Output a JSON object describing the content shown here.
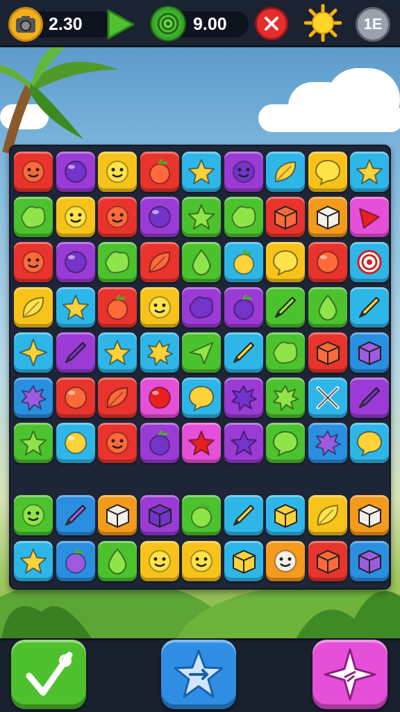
{
  "hud": {
    "coins_value": "2.30",
    "gems_value": "9.00",
    "level_badge": "1E"
  },
  "colors": {
    "red": "#e8342c",
    "purple": "#9b3bd6",
    "yellow": "#f7c31b",
    "cyan": "#2fb6e8",
    "green": "#4cc22f",
    "orange": "#f49a1c",
    "blue": "#2a8fe0",
    "pink": "#e64fd8"
  },
  "board": {
    "rows": [
      [
        [
          "red",
          "face"
        ],
        [
          "purple",
          "ball"
        ],
        [
          "yellow",
          "face"
        ],
        [
          "red",
          "apple"
        ],
        [
          "cyan",
          "star"
        ],
        [
          "purple",
          "face"
        ],
        [
          "cyan",
          "leaf"
        ],
        [
          "yellow",
          "bubble"
        ],
        [
          "cyan",
          "star"
        ]
      ],
      [
        [
          "green",
          "blob"
        ],
        [
          "yellow",
          "face"
        ],
        [
          "red",
          "face"
        ],
        [
          "purple",
          "ball"
        ],
        [
          "green",
          "star"
        ],
        [
          "green",
          "blob"
        ],
        [
          "red",
          "box"
        ],
        [
          "orange",
          "box"
        ],
        [
          "pink",
          "triangle"
        ]
      ],
      [
        [
          "red",
          "face"
        ],
        [
          "purple",
          "ball"
        ],
        [
          "green",
          "blob"
        ],
        [
          "red",
          "leaf"
        ],
        [
          "green",
          "drop"
        ],
        [
          "cyan",
          "apple"
        ],
        [
          "yellow",
          "bubble"
        ],
        [
          "red",
          "ball"
        ],
        [
          "cyan",
          "target"
        ]
      ],
      [
        [
          "yellow",
          "leaf"
        ],
        [
          "cyan",
          "star"
        ],
        [
          "red",
          "apple"
        ],
        [
          "yellow",
          "face"
        ],
        [
          "purple",
          "blob"
        ],
        [
          "purple",
          "apple"
        ],
        [
          "green",
          "pencil"
        ],
        [
          "green",
          "drop"
        ],
        [
          "cyan",
          "pencil"
        ]
      ],
      [
        [
          "cyan",
          "star4"
        ],
        [
          "purple",
          "pencil"
        ],
        [
          "cyan",
          "star"
        ],
        [
          "cyan",
          "splat"
        ],
        [
          "green",
          "plane"
        ],
        [
          "cyan",
          "pencil"
        ],
        [
          "green",
          "blob"
        ],
        [
          "red",
          "box"
        ],
        [
          "blue",
          "box"
        ]
      ],
      [
        [
          "blue",
          "splat"
        ],
        [
          "red",
          "ball"
        ],
        [
          "red",
          "leaf"
        ],
        [
          "pink",
          "ball"
        ],
        [
          "cyan",
          "bubble"
        ],
        [
          "purple",
          "splat"
        ],
        [
          "green",
          "splat"
        ],
        [
          "cyan",
          "tools"
        ],
        [
          "purple",
          "pencil"
        ]
      ],
      [
        [
          "green",
          "star"
        ],
        [
          "cyan",
          "ball"
        ],
        [
          "red",
          "face"
        ],
        [
          "purple",
          "apple"
        ],
        [
          "pink",
          "star"
        ],
        [
          "purple",
          "star"
        ],
        [
          "green",
          "bubble"
        ],
        [
          "blue",
          "splat"
        ],
        [
          "cyan",
          "bubble"
        ]
      ],
      [
        [
          "green",
          "face"
        ],
        [
          "blue",
          "pencil"
        ],
        [
          "orange",
          "box"
        ],
        [
          "purple",
          "box"
        ],
        [
          "green",
          "apple"
        ],
        [
          "cyan",
          "pencil"
        ],
        [
          "cyan",
          "box"
        ],
        [
          "yellow",
          "leaf"
        ],
        [
          "orange",
          "box"
        ]
      ],
      [
        [
          "cyan",
          "star"
        ],
        [
          "blue",
          "apple"
        ],
        [
          "green",
          "drop"
        ],
        [
          "yellow",
          "face"
        ],
        [
          "yellow",
          "face"
        ],
        [
          "cyan",
          "box"
        ],
        [
          "orange",
          "face"
        ],
        [
          "red",
          "box"
        ],
        [
          "blue",
          "box"
        ]
      ]
    ]
  },
  "buttons": {
    "left_icon": "checkmark-icon",
    "middle_icon": "shuffle-star-icon",
    "right_icon": "sparkle-icon"
  }
}
